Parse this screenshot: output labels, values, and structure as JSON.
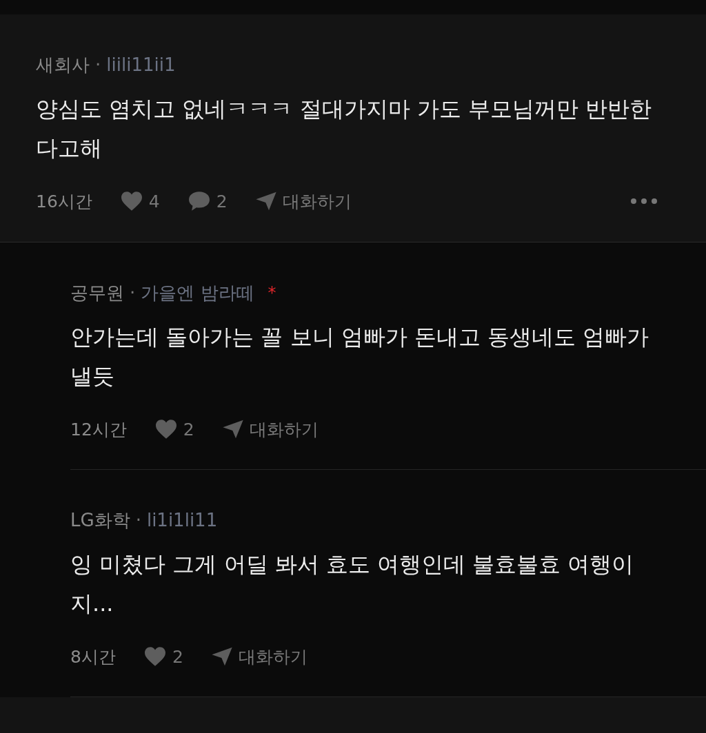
{
  "comments": [
    {
      "kind": "comment",
      "company": "새회사",
      "separator": "·",
      "nickname": "liili11ii1",
      "text": "양심도 염치고 없네ㅋㅋㅋ 절대가지마 가도 부모님꺼만 반반한다고해",
      "time": "16시간",
      "likes": "4",
      "replies": "2",
      "action": "대화하기",
      "more_menu": true
    },
    {
      "kind": "reply",
      "company": "공무원",
      "separator": "·",
      "nickname": "가을엔 밤라떼",
      "mark": "*",
      "text": "안가는데 돌아가는 꼴 보니 엄빠가 돈내고 동생네도 엄빠가 낼듯",
      "time": "12시간",
      "likes": "2",
      "action": "대화하기",
      "more_menu": false
    },
    {
      "kind": "reply",
      "company": "LG화학",
      "separator": "·",
      "nickname": "li1i1li11",
      "text": "잉 미쳤다 그게 어딜 봐서 효도 여행인데 불효불효 여행이지...",
      "time": "8시간",
      "likes": "2",
      "action": "대화하기",
      "more_menu": false
    }
  ]
}
